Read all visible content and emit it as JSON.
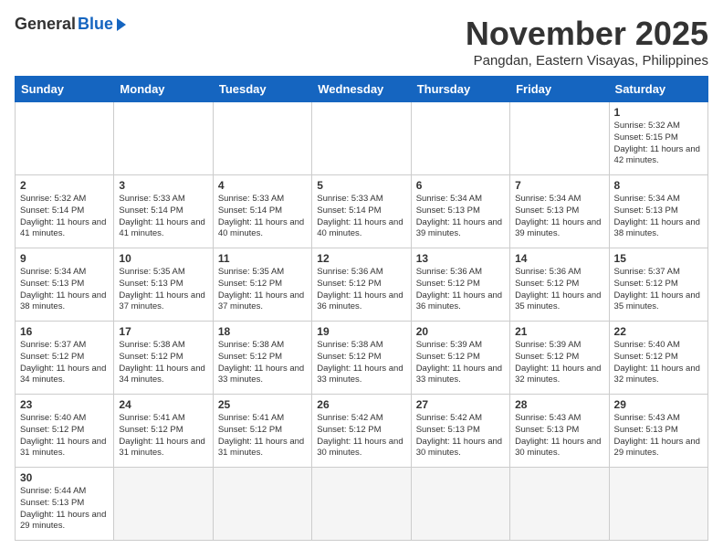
{
  "header": {
    "logo_general": "General",
    "logo_blue": "Blue",
    "month_title": "November 2025",
    "location": "Pangdan, Eastern Visayas, Philippines"
  },
  "days_of_week": [
    "Sunday",
    "Monday",
    "Tuesday",
    "Wednesday",
    "Thursday",
    "Friday",
    "Saturday"
  ],
  "weeks": [
    [
      {
        "day": "",
        "info": ""
      },
      {
        "day": "",
        "info": ""
      },
      {
        "day": "",
        "info": ""
      },
      {
        "day": "",
        "info": ""
      },
      {
        "day": "",
        "info": ""
      },
      {
        "day": "",
        "info": ""
      },
      {
        "day": "1",
        "info": "Sunrise: 5:32 AM\nSunset: 5:15 PM\nDaylight: 11 hours\nand 42 minutes."
      }
    ],
    [
      {
        "day": "2",
        "info": "Sunrise: 5:32 AM\nSunset: 5:14 PM\nDaylight: 11 hours\nand 41 minutes."
      },
      {
        "day": "3",
        "info": "Sunrise: 5:33 AM\nSunset: 5:14 PM\nDaylight: 11 hours\nand 41 minutes."
      },
      {
        "day": "4",
        "info": "Sunrise: 5:33 AM\nSunset: 5:14 PM\nDaylight: 11 hours\nand 40 minutes."
      },
      {
        "day": "5",
        "info": "Sunrise: 5:33 AM\nSunset: 5:14 PM\nDaylight: 11 hours\nand 40 minutes."
      },
      {
        "day": "6",
        "info": "Sunrise: 5:34 AM\nSunset: 5:13 PM\nDaylight: 11 hours\nand 39 minutes."
      },
      {
        "day": "7",
        "info": "Sunrise: 5:34 AM\nSunset: 5:13 PM\nDaylight: 11 hours\nand 39 minutes."
      },
      {
        "day": "8",
        "info": "Sunrise: 5:34 AM\nSunset: 5:13 PM\nDaylight: 11 hours\nand 38 minutes."
      }
    ],
    [
      {
        "day": "9",
        "info": "Sunrise: 5:34 AM\nSunset: 5:13 PM\nDaylight: 11 hours\nand 38 minutes."
      },
      {
        "day": "10",
        "info": "Sunrise: 5:35 AM\nSunset: 5:13 PM\nDaylight: 11 hours\nand 37 minutes."
      },
      {
        "day": "11",
        "info": "Sunrise: 5:35 AM\nSunset: 5:12 PM\nDaylight: 11 hours\nand 37 minutes."
      },
      {
        "day": "12",
        "info": "Sunrise: 5:36 AM\nSunset: 5:12 PM\nDaylight: 11 hours\nand 36 minutes."
      },
      {
        "day": "13",
        "info": "Sunrise: 5:36 AM\nSunset: 5:12 PM\nDaylight: 11 hours\nand 36 minutes."
      },
      {
        "day": "14",
        "info": "Sunrise: 5:36 AM\nSunset: 5:12 PM\nDaylight: 11 hours\nand 35 minutes."
      },
      {
        "day": "15",
        "info": "Sunrise: 5:37 AM\nSunset: 5:12 PM\nDaylight: 11 hours\nand 35 minutes."
      }
    ],
    [
      {
        "day": "16",
        "info": "Sunrise: 5:37 AM\nSunset: 5:12 PM\nDaylight: 11 hours\nand 34 minutes."
      },
      {
        "day": "17",
        "info": "Sunrise: 5:38 AM\nSunset: 5:12 PM\nDaylight: 11 hours\nand 34 minutes."
      },
      {
        "day": "18",
        "info": "Sunrise: 5:38 AM\nSunset: 5:12 PM\nDaylight: 11 hours\nand 33 minutes."
      },
      {
        "day": "19",
        "info": "Sunrise: 5:38 AM\nSunset: 5:12 PM\nDaylight: 11 hours\nand 33 minutes."
      },
      {
        "day": "20",
        "info": "Sunrise: 5:39 AM\nSunset: 5:12 PM\nDaylight: 11 hours\nand 33 minutes."
      },
      {
        "day": "21",
        "info": "Sunrise: 5:39 AM\nSunset: 5:12 PM\nDaylight: 11 hours\nand 32 minutes."
      },
      {
        "day": "22",
        "info": "Sunrise: 5:40 AM\nSunset: 5:12 PM\nDaylight: 11 hours\nand 32 minutes."
      }
    ],
    [
      {
        "day": "23",
        "info": "Sunrise: 5:40 AM\nSunset: 5:12 PM\nDaylight: 11 hours\nand 31 minutes."
      },
      {
        "day": "24",
        "info": "Sunrise: 5:41 AM\nSunset: 5:12 PM\nDaylight: 11 hours\nand 31 minutes."
      },
      {
        "day": "25",
        "info": "Sunrise: 5:41 AM\nSunset: 5:12 PM\nDaylight: 11 hours\nand 31 minutes."
      },
      {
        "day": "26",
        "info": "Sunrise: 5:42 AM\nSunset: 5:12 PM\nDaylight: 11 hours\nand 30 minutes."
      },
      {
        "day": "27",
        "info": "Sunrise: 5:42 AM\nSunset: 5:13 PM\nDaylight: 11 hours\nand 30 minutes."
      },
      {
        "day": "28",
        "info": "Sunrise: 5:43 AM\nSunset: 5:13 PM\nDaylight: 11 hours\nand 30 minutes."
      },
      {
        "day": "29",
        "info": "Sunrise: 5:43 AM\nSunset: 5:13 PM\nDaylight: 11 hours\nand 29 minutes."
      }
    ],
    [
      {
        "day": "30",
        "info": "Sunrise: 5:44 AM\nSunset: 5:13 PM\nDaylight: 11 hours\nand 29 minutes."
      },
      {
        "day": "",
        "info": ""
      },
      {
        "day": "",
        "info": ""
      },
      {
        "day": "",
        "info": ""
      },
      {
        "day": "",
        "info": ""
      },
      {
        "day": "",
        "info": ""
      },
      {
        "day": "",
        "info": ""
      }
    ]
  ]
}
